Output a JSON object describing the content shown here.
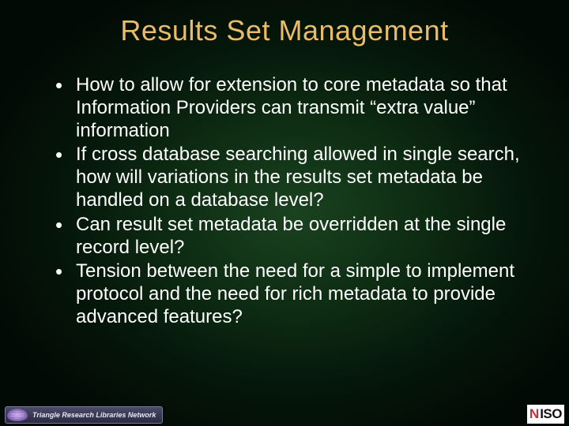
{
  "title": "Results Set Management",
  "bullets": [
    "How to allow for extension to core metadata so that Information Providers can transmit “extra value” information",
    "If cross database searching allowed in single search, how will variations in the results set metadata be handled on a database level?",
    "Can result set metadata be overridden at the single record level?",
    "Tension between the need for a simple to implement protocol and the need for rich metadata to provide advanced features?"
  ],
  "footer": {
    "left_org": "Triangle Research Libraries Network",
    "right_org_n": "N",
    "right_org_iso": "ISO"
  }
}
